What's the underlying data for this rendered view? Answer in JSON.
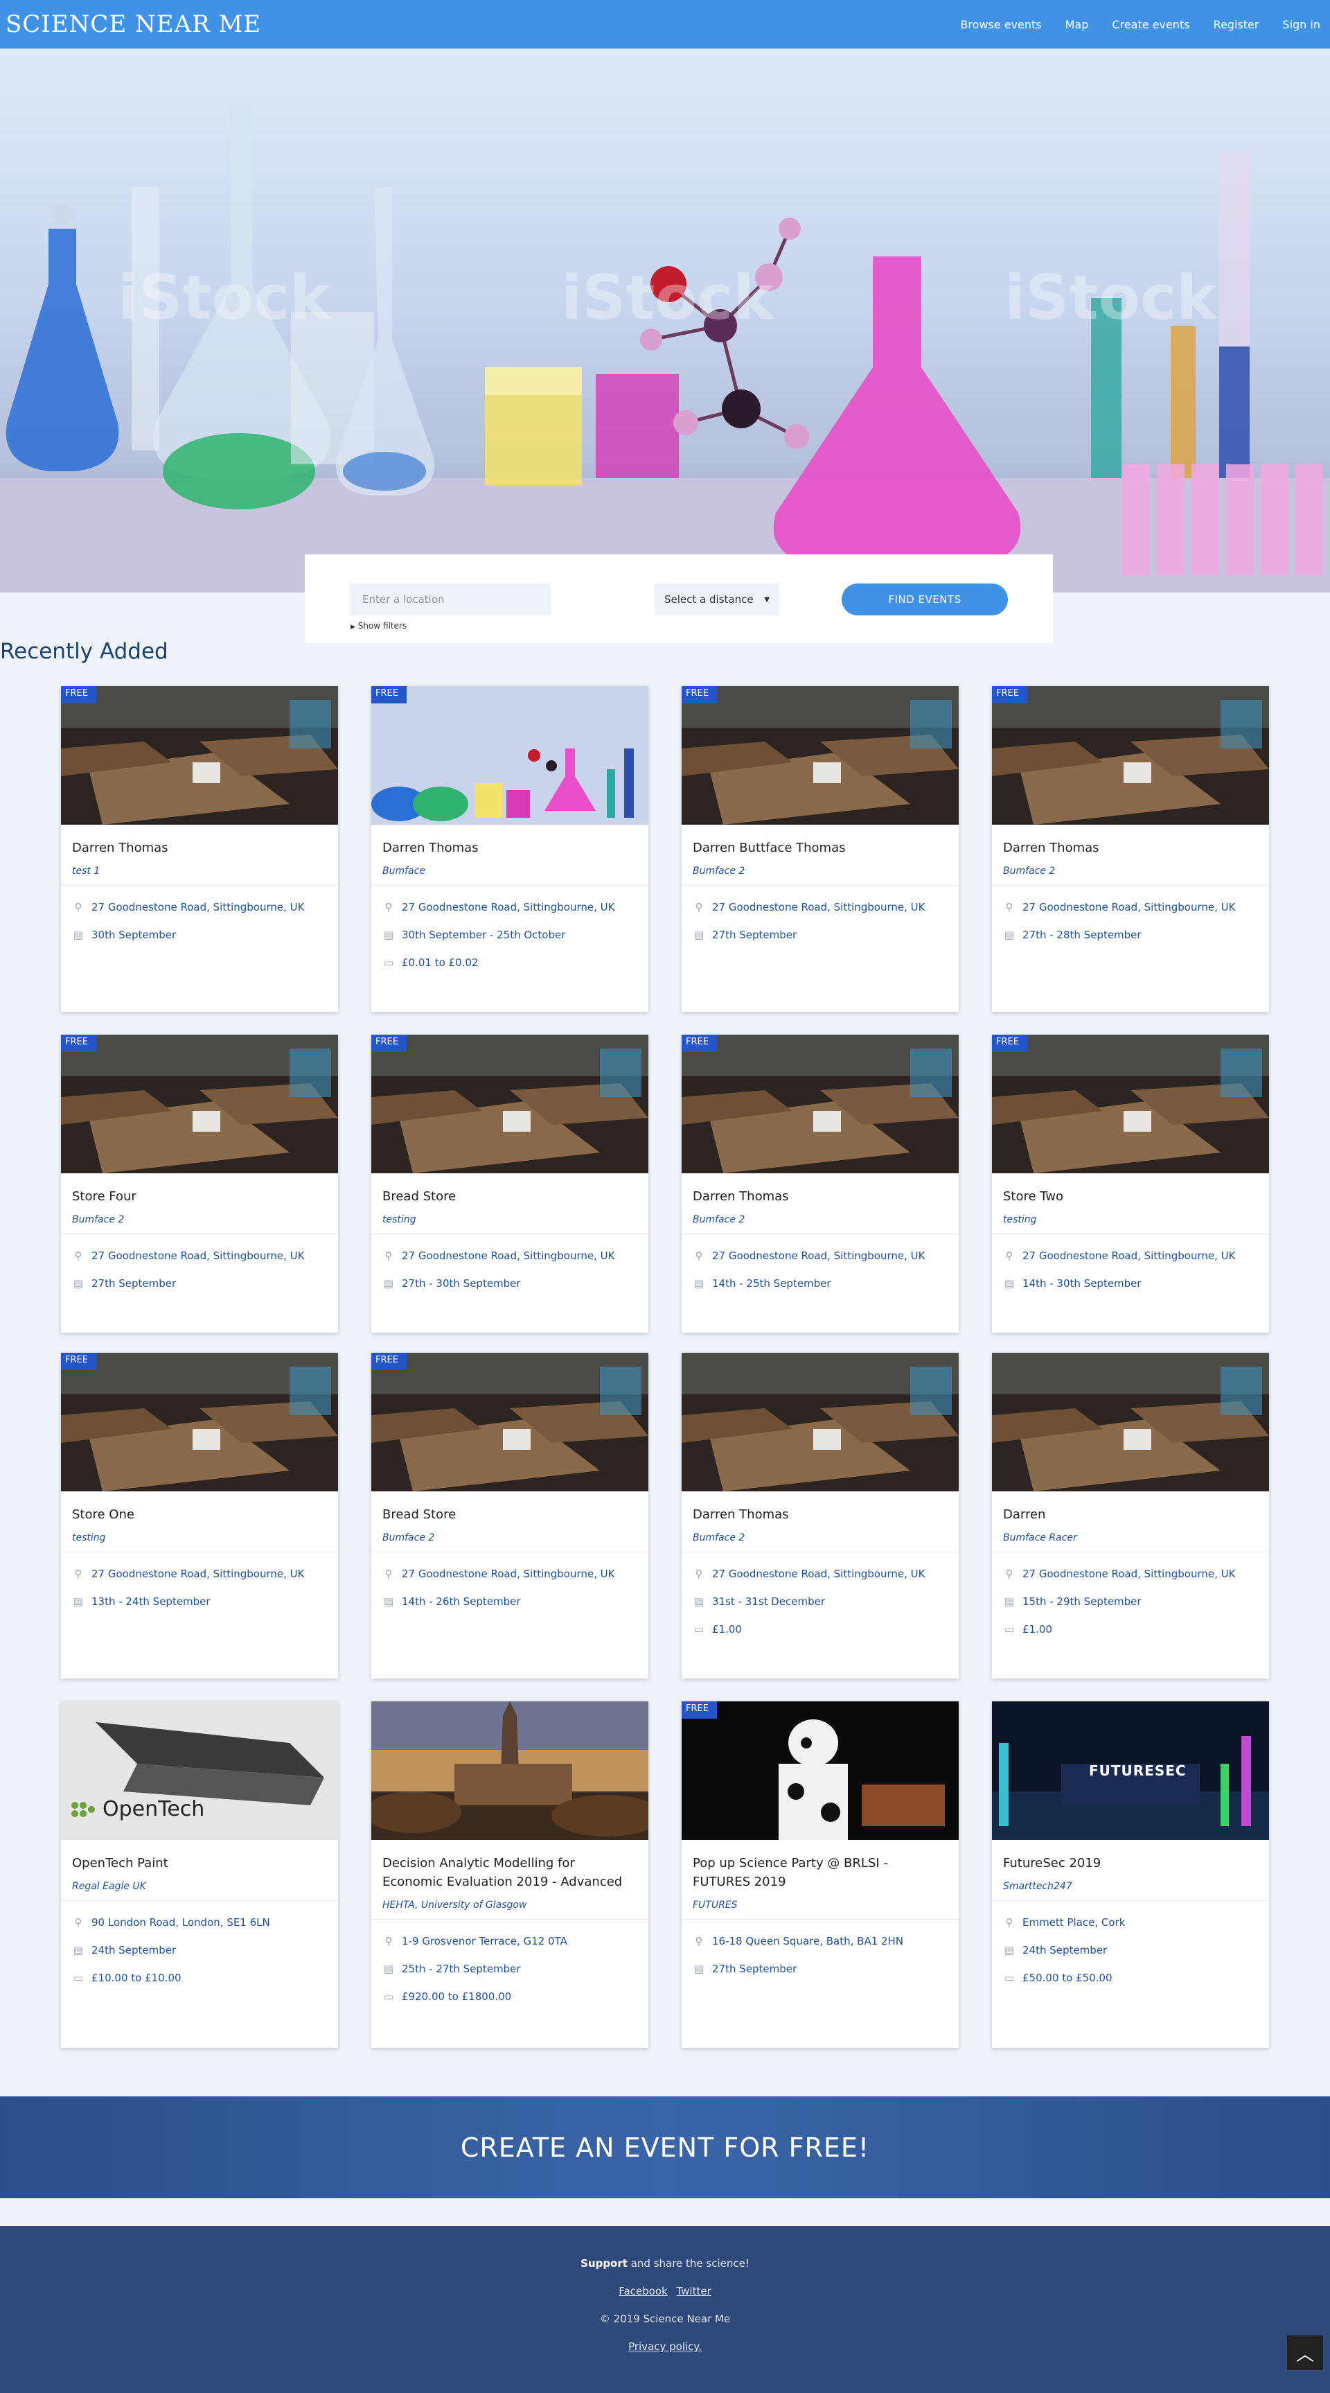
{
  "nav": {
    "logo": "SCIENCE NEAR ME",
    "links": [
      "Browse events",
      "Map",
      "Create events",
      "Register",
      "Sign in"
    ]
  },
  "search": {
    "placeholder": "Enter a location",
    "distance": "Select a distance",
    "find_label": "FIND EVENTS",
    "filters_label": "Show filters"
  },
  "section_title": "Recently Added",
  "badge_label": "FREE",
  "cards": [
    {
      "title": "Darren Thomas",
      "org": "test 1",
      "location": "27 Goodnestone Road, Sittingbourne, UK",
      "date": "30th September",
      "price": "",
      "free": true,
      "image": "cafe"
    },
    {
      "title": "Darren Thomas",
      "org": "Bumface",
      "location": "27 Goodnestone Road, Sittingbourne, UK",
      "date": "30th September - 25th October",
      "price": "£0.01 to £0.02",
      "free": true,
      "image": "lab"
    },
    {
      "title": "Darren Buttface Thomas",
      "org": "Bumface 2",
      "location": "27 Goodnestone Road, Sittingbourne, UK",
      "date": "27th September",
      "price": "",
      "free": true,
      "image": "cafe"
    },
    {
      "title": "Darren Thomas",
      "org": "Bumface 2",
      "location": "27 Goodnestone Road, Sittingbourne, UK",
      "date": "27th - 28th September",
      "price": "",
      "free": true,
      "image": "cafe"
    },
    {
      "title": "Store Four",
      "org": "Bumface 2",
      "location": "27 Goodnestone Road, Sittingbourne, UK",
      "date": "27th September",
      "price": "",
      "free": true,
      "image": "cafe"
    },
    {
      "title": "Bread Store",
      "org": "testing",
      "location": "27 Goodnestone Road, Sittingbourne, UK",
      "date": "27th - 30th September",
      "price": "",
      "free": true,
      "image": "cafe"
    },
    {
      "title": "Darren Thomas",
      "org": "Bumface 2",
      "location": "27 Goodnestone Road, Sittingbourne, UK",
      "date": "14th - 25th September",
      "price": "",
      "free": true,
      "image": "cafe"
    },
    {
      "title": "Store Two",
      "org": "testing",
      "location": "27 Goodnestone Road, Sittingbourne, UK",
      "date": "14th - 30th September",
      "price": "",
      "free": true,
      "image": "cafe"
    },
    {
      "title": "Store One",
      "org": "testing",
      "location": "27 Goodnestone Road, Sittingbourne, UK",
      "date": "13th - 24th September",
      "price": "",
      "free": true,
      "image": "cafe"
    },
    {
      "title": "Bread Store",
      "org": "Bumface 2",
      "location": "27 Goodnestone Road, Sittingbourne, UK",
      "date": "14th - 26th September",
      "price": "",
      "free": true,
      "image": "cafe"
    },
    {
      "title": "Darren Thomas",
      "org": "Bumface 2",
      "location": "27 Goodnestone Road, Sittingbourne, UK",
      "date": "31st - 31st December",
      "price": "£1.00",
      "free": false,
      "image": "cafe"
    },
    {
      "title": "Darren",
      "org": "Bumface Racer",
      "location": "27 Goodnestone Road, Sittingbourne, UK",
      "date": "15th - 29th September",
      "price": "£1.00",
      "free": false,
      "image": "cafe"
    },
    {
      "title": "OpenTech Paint",
      "org": "Regal Eagle UK",
      "location": "90 London Road, London, SE1 6LN",
      "date": "24th September",
      "price": "£10.00 to £10.00",
      "free": false,
      "image": "opentech",
      "image_text": "OpenTech"
    },
    {
      "title": "Decision Analytic Modelling for Economic Evaluation 2019 - Advanced",
      "org": "HEHTA, University of Glasgow",
      "location": "1-9 Grosvenor Terrace, G12 0TA",
      "date": "25th - 27th September",
      "price": "£920.00 to £1800.00",
      "free": false,
      "image": "glasgow"
    },
    {
      "title": "Pop up Science Party @ BRLSI - FUTURES 2019",
      "org": "FUTURES",
      "location": "16-18 Queen Square, Bath, BA1 2HN",
      "date": "27th September",
      "price": "",
      "free": true,
      "image": "futures"
    },
    {
      "title": "FutureSec 2019",
      "org": "Smarttech247",
      "location": "Emmett Place, Cork",
      "date": "24th September",
      "price": "£50.00 to £50.00",
      "free": false,
      "image": "futuresec",
      "image_text": "FUTURESEC"
    }
  ],
  "cta": "CREATE AN EVENT FOR FREE!",
  "footer": {
    "support_bold": "Support",
    "support_rest": " and share the science!",
    "facebook": "Facebook",
    "twitter": "Twitter",
    "copyright": "© 2019 Science Near Me",
    "privacy": "Privacy policy."
  },
  "colors": {
    "nav": "#3f92e6",
    "accent": "#2456c7",
    "link": "#1d4f9e",
    "footer": "#2f4a7a"
  },
  "icons": {
    "location": "map-pin-icon",
    "date": "calendar-icon",
    "price": "ticket-icon",
    "to_top": "chevron-up-icon"
  }
}
